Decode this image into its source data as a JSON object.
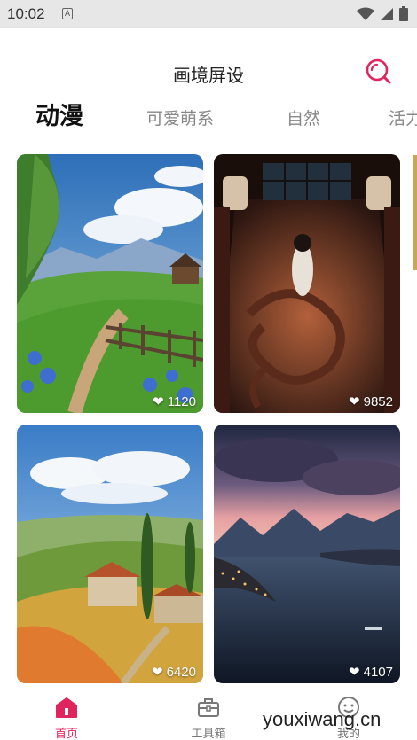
{
  "status_bar": {
    "time": "10:02",
    "notification_badge": "A"
  },
  "header": {
    "title": "画境屏设",
    "search_icon": "search-icon"
  },
  "tabs": [
    {
      "label": "动漫",
      "active": true
    },
    {
      "label": "可爱萌系",
      "active": false
    },
    {
      "label": "自然",
      "active": false
    },
    {
      "label": "活力",
      "active": false
    }
  ],
  "wallpapers": [
    {
      "likes": "1120",
      "scene": "mountain meadow path with cabin"
    },
    {
      "likes": "9852",
      "scene": "girl in temple with dragon floor"
    },
    {
      "likes": "6420",
      "scene": "tuscan hills with cypress and farmhouse"
    },
    {
      "likes": "4107",
      "scene": "lakeside town at dusk with mountains"
    }
  ],
  "bottom_nav": [
    {
      "label": "首页",
      "icon": "home-icon",
      "active": true
    },
    {
      "label": "工具箱",
      "icon": "toolbox-icon",
      "active": false
    },
    {
      "label": "我的",
      "icon": "smiley-icon",
      "active": false
    }
  ],
  "watermark": "youxiwang.cn",
  "colors": {
    "accent": "#e0245e",
    "tab_inactive": "#888888",
    "status_bar": "#e7e7e7"
  }
}
